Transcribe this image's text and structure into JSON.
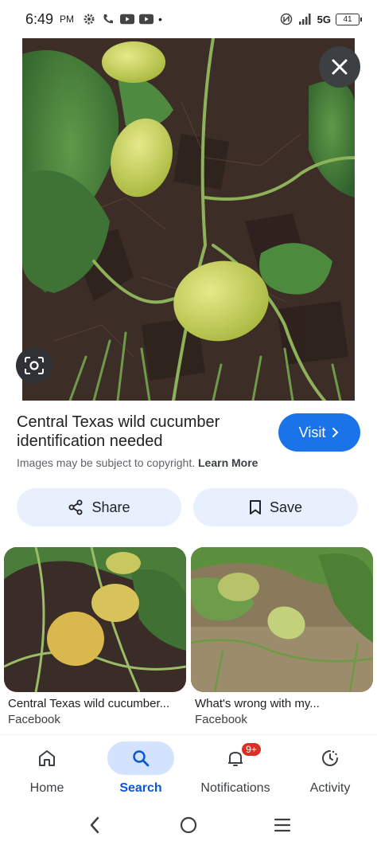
{
  "status_bar": {
    "time": "6:49",
    "ampm": "PM",
    "network": "5G",
    "battery": "41"
  },
  "result": {
    "title": "Central Texas wild cucumber identification needed",
    "visit_label": "Visit",
    "copyright_text": "Images may be subject to copyright.",
    "learn_more": "Learn More"
  },
  "actions": {
    "share_label": "Share",
    "save_label": "Save"
  },
  "related": [
    {
      "title": "Central Texas wild cucumber...",
      "source": "Facebook"
    },
    {
      "title": "What's wrong with my...",
      "source": "Facebook"
    }
  ],
  "bottom_nav": {
    "items": [
      {
        "label": "Home",
        "icon": "home-icon"
      },
      {
        "label": "Search",
        "icon": "search-icon",
        "active": true
      },
      {
        "label": "Notifications",
        "icon": "bell-icon",
        "badge": "9+"
      },
      {
        "label": "Activity",
        "icon": "activity-icon"
      }
    ]
  },
  "colors": {
    "accent": "#1a73e8",
    "pill_bg": "#e8f0fe",
    "active_nav_bg": "#d3e3fd",
    "badge": "#d93025"
  }
}
